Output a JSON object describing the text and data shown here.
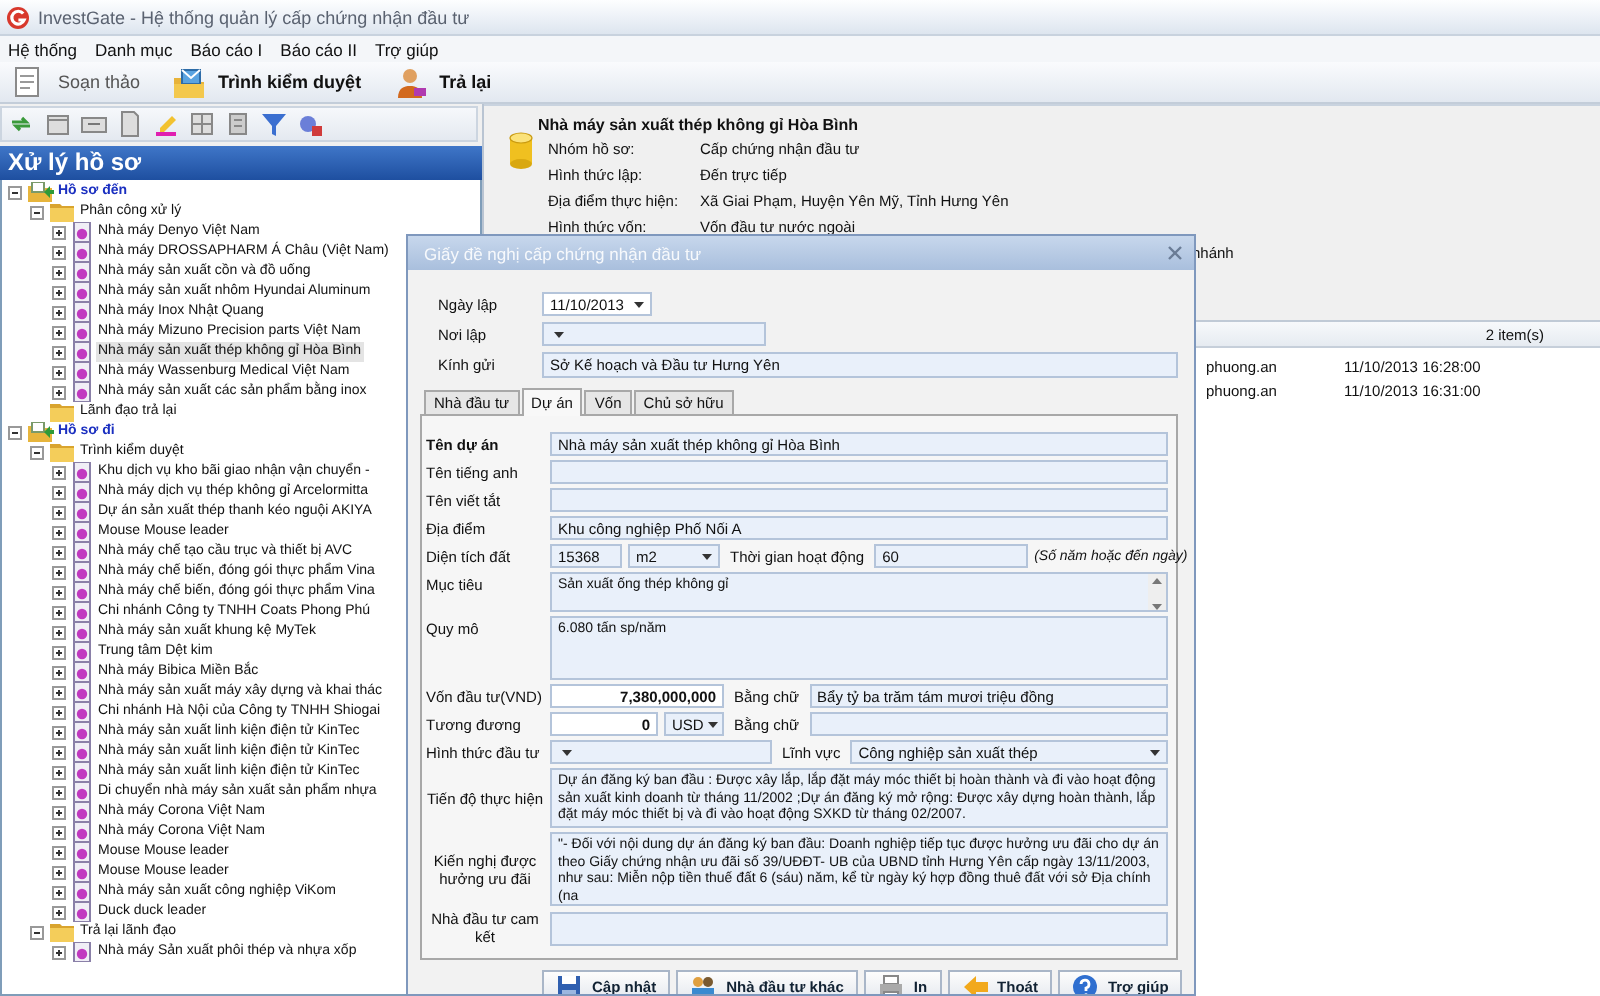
{
  "window": {
    "title": "InvestGate - Hệ thống quản lý cấp chứng nhận đầu tư"
  },
  "menu": [
    "Hệ thống",
    "Danh mục",
    "Báo cáo I",
    "Báo cáo II",
    "Trợ giúp"
  ],
  "toolbar": [
    {
      "label": "Soạn thảo",
      "disabled": true
    },
    {
      "label": "Trình kiểm duyệt",
      "disabled": false
    },
    {
      "label": "Trả lại",
      "disabled": false
    }
  ],
  "side_panel": {
    "title": "Xử lý hồ sơ",
    "tree": [
      {
        "kind": "root",
        "label": "Hồ sơ đến",
        "expanded": true,
        "selected": false,
        "children": [
          {
            "kind": "folder",
            "label": "Phân công xử lý",
            "expanded": true,
            "selected": false,
            "children": [
              {
                "kind": "item",
                "label": "Nhà máy Denyo Việt Nam",
                "expanded": false,
                "selected": false
              },
              {
                "kind": "item",
                "label": "Nhà máy DROSSAPHARM Á Châu (Việt Nam)",
                "expanded": false,
                "selected": false
              },
              {
                "kind": "item",
                "label": "Nhà máy sản xuất cồn và đồ uống",
                "expanded": false,
                "selected": false
              },
              {
                "kind": "item",
                "label": "Nhà máy sản xuất nhôm Hyundai Aluminum",
                "expanded": false,
                "selected": false
              },
              {
                "kind": "item",
                "label": "Nhà máy Inox Nhật Quang",
                "expanded": false,
                "selected": false
              },
              {
                "kind": "item",
                "label": "Nhà máy Mizuno Precision parts Việt Nam",
                "expanded": false,
                "selected": false
              },
              {
                "kind": "item",
                "label": "Nhà máy sản xuất thép không gỉ Hòa Bình",
                "expanded": false,
                "selected": true
              },
              {
                "kind": "item",
                "label": "Nhà máy Wassenburg Medical Việt Nam",
                "expanded": false,
                "selected": false
              },
              {
                "kind": "item",
                "label": "Nhà máy sản xuất các sản phẩm bằng inox",
                "expanded": false,
                "selected": false
              }
            ]
          },
          {
            "kind": "folder",
            "label": "Lãnh đạo trả lại",
            "selected": false
          }
        ]
      },
      {
        "kind": "root",
        "label": "Hồ sơ đi",
        "expanded": true,
        "selected": false,
        "children": [
          {
            "kind": "folder",
            "label": "Trình kiểm duyệt",
            "expanded": true,
            "selected": false,
            "children": [
              {
                "kind": "item",
                "label": "Khu dịch vụ kho bãi giao nhận vận chuyển -",
                "expanded": false,
                "selected": false
              },
              {
                "kind": "item",
                "label": "Nhà máy dịch vụ thép không gỉ Arcelormitta",
                "expanded": false,
                "selected": false
              },
              {
                "kind": "item",
                "label": "Dự án sản xuất thép thanh kéo nguội AKIYA",
                "expanded": false,
                "selected": false
              },
              {
                "kind": "item",
                "label": "Mouse Mouse leader",
                "expanded": false,
                "selected": false
              },
              {
                "kind": "item",
                "label": "Nhà máy chế tạo cầu trục và thiết bị AVC",
                "expanded": false,
                "selected": false
              },
              {
                "kind": "item",
                "label": "Nhà máy chế biến, đóng gói thực phẩm Vina",
                "expanded": false,
                "selected": false
              },
              {
                "kind": "item",
                "label": "Nhà máy chế biến, đóng gói thực phẩm Vina",
                "expanded": false,
                "selected": false
              },
              {
                "kind": "item",
                "label": "Chi nhánh Công ty TNHH Coats Phong Phú",
                "expanded": false,
                "selected": false
              },
              {
                "kind": "item",
                "label": "Nhà máy sản xuất khung kệ MyTek",
                "expanded": false,
                "selected": false
              },
              {
                "kind": "item",
                "label": "Trung tâm Dệt kim",
                "expanded": false,
                "selected": false
              },
              {
                "kind": "item",
                "label": "Nhà máy Bibica Miền Bắc",
                "expanded": false,
                "selected": false
              },
              {
                "kind": "item",
                "label": "Nhà máy sản xuất máy xây dựng và khai thác",
                "expanded": false,
                "selected": false
              },
              {
                "kind": "item",
                "label": "Chi nhánh Hà Nội của Công ty TNHH Shiogai",
                "expanded": false,
                "selected": false
              },
              {
                "kind": "item",
                "label": "Nhà máy sản xuất linh kiện điện tử KinTec",
                "expanded": false,
                "selected": false
              },
              {
                "kind": "item",
                "label": "Nhà máy sản xuất linh kiện điện tử KinTec",
                "expanded": false,
                "selected": false
              },
              {
                "kind": "item",
                "label": "Nhà máy sản xuất linh kiện điện tử KinTec",
                "expanded": false,
                "selected": false
              },
              {
                "kind": "item",
                "label": "Di chuyển nhà máy sản xuất sản phẩm nhựa",
                "expanded": false,
                "selected": false
              },
              {
                "kind": "item",
                "label": "Nhà máy Corona Việt Nam",
                "expanded": false,
                "selected": false
              },
              {
                "kind": "item",
                "label": "Nhà máy Corona Việt Nam",
                "expanded": false,
                "selected": false
              },
              {
                "kind": "item",
                "label": "Mouse Mouse leader",
                "expanded": false,
                "selected": false
              },
              {
                "kind": "item",
                "label": "Mouse Mouse leader",
                "expanded": false,
                "selected": false
              },
              {
                "kind": "item",
                "label": "Nhà máy sản xuất công nghiệp ViKom",
                "expanded": false,
                "selected": false
              },
              {
                "kind": "item",
                "label": "Duck duck leader",
                "expanded": false,
                "selected": false
              }
            ]
          },
          {
            "kind": "folder",
            "label": "Trả lại lãnh đạo",
            "expanded": true,
            "selected": false,
            "children": [
              {
                "kind": "item",
                "label": "Nhà máy Sản xuất phôi thép và nhựa xốp",
                "expanded": false,
                "selected": false
              }
            ]
          }
        ]
      }
    ]
  },
  "details": {
    "title": "Nhà máy sản xuất thép không gỉ Hòa Bình",
    "fields": [
      {
        "label": "Nhóm hồ sơ:",
        "value": "Cấp chứng nhận đầu tư"
      },
      {
        "label": "Hình thức lập:",
        "value": "Đến trực tiếp"
      },
      {
        "label": "Địa điểm thực hiện:",
        "value": "Xã Giai Phạm, Huyện Yên Mỹ, Tỉnh Hưng Yên"
      },
      {
        "label": "Hình thức vốn:",
        "value": "Vốn đầu tư nước ngoài"
      }
    ],
    "partial_value": "nhánh"
  },
  "history": {
    "count": "2 item(s)",
    "rows": [
      {
        "user": "phuong.an",
        "time": "11/10/2013 16:28:00"
      },
      {
        "user": "phuong.an",
        "time": "11/10/2013 16:31:00"
      }
    ]
  },
  "dialog": {
    "title": "Giấy đề nghị cấp chứng nhận đầu tư",
    "header_fields": [
      {
        "kind": "date",
        "label": "Ngày lập",
        "value": "11/10/2013"
      },
      {
        "kind": "dropdown",
        "label": "Nơi lập"
      },
      {
        "kind": "text",
        "label": "Kính gửi",
        "value": "Sở Kế hoạch và Đầu tư Hưng Yên"
      }
    ],
    "tabs": [
      {
        "label": "Nhà đầu tư",
        "selected": false
      },
      {
        "label": "Dự án",
        "selected": true
      },
      {
        "label": "Vốn",
        "selected": false
      },
      {
        "label": "Chủ sở hữu",
        "selected": false
      }
    ],
    "rows": [
      {
        "kind": "text",
        "label": "Tên dự án",
        "required": true,
        "value": "Nhà máy sản xuất thép không gỉ Hòa Bình"
      },
      {
        "kind": "text",
        "label": "Tên tiếng anh",
        "required": false
      },
      {
        "kind": "text",
        "label": "Tên viết tắt",
        "required": false
      },
      {
        "kind": "text",
        "label": "Địa điểm",
        "required": false,
        "value": "Khu công nghiệp Phố Nối A"
      },
      {
        "kind": "area",
        "label": "Diện tích đất",
        "required": false,
        "value": "15368",
        "unit": "m2",
        "duration_label": "Thời gian hoạt động",
        "duration": "60",
        "hint": "(Số năm hoặc đến ngày)"
      },
      {
        "kind": "memo",
        "label": "Mục tiêu",
        "required": false,
        "scrollable": true,
        "value": "Sản xuất ống thép không gỉ"
      },
      {
        "kind": "memo",
        "label": "Quy mô",
        "required": false,
        "scrollable": false,
        "value": "6.080 tấn sp/năm"
      },
      {
        "kind": "money",
        "label": "Vốn đầu tư(VND)",
        "required": false,
        "amount": "7,380,000,000",
        "words_label": "Bằng chữ",
        "words": "Bẩy tỷ ba trăm tám mươi triệu đồng"
      },
      {
        "kind": "money",
        "label": "Tương đương",
        "required": false,
        "amount": "0",
        "currency": "USD",
        "words_label": "Bằng chữ"
      },
      {
        "kind": "selects",
        "label": "Hình thức đầu tư",
        "required": false,
        "second_label": "Lĩnh vực",
        "second_value": "Công nghiệp sản xuất thép"
      },
      {
        "kind": "memo",
        "label": "Tiến độ thực hiện",
        "required": false,
        "scrollable": false,
        "value": "Dự án đăng ký ban đầu : Được xây lắp, lắp đặt máy móc thiết bị hoàn thành và đi vào hoạt động sản xuất kinh doanh từ tháng 11/2002 ;Dự án đăng ký mở rộng: Được xây dựng hoàn thành, lắp đặt máy móc thiết bị và đi vào hoạt động SXKD từ tháng 02/2007."
      },
      {
        "kind": "memo",
        "label": "Kiến nghị được hưởng ưu đãi",
        "required": false,
        "scrollable": false,
        "value": "\"- Đối với nội dung dự án đăng ký ban đầu: Doanh nghiệp tiếp tục được hưởng ưu đãi cho dự án theo Giấy chứng nhận ưu đãi số 39/UĐĐT- UB của UBND tỉnh Hưng Yên cấp ngày 13/11/2003, như sau: Miễn nộp tiền thuế đất 6 (sáu) năm, kể từ ngày ký hợp đồng thuê đất với sở Địa chính (na"
      },
      {
        "kind": "memo",
        "label": "Nhà đầu tư cam kết",
        "required": false,
        "scrollable": false
      }
    ],
    "buttons": [
      "Cập nhật",
      "Nhà đầu tư khác",
      "In",
      "Thoát",
      "Trợ giúp"
    ]
  }
}
